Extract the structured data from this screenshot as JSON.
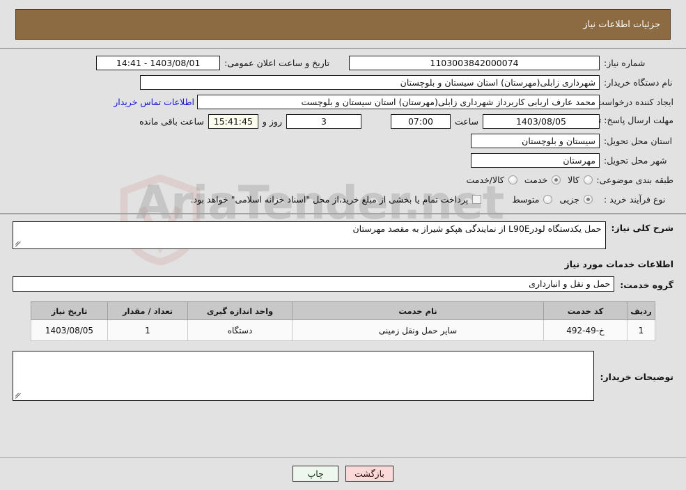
{
  "header": {
    "title": "جزئیات اطلاعات نیاز"
  },
  "watermark": {
    "text": "AriaTender.net",
    "shield_color": "#d4a0a0"
  },
  "form": {
    "need_number_label": "شماره نیاز:",
    "need_number_value": "1103003842000074",
    "announce_datetime_label": "تاریخ و ساعت اعلان عمومی:",
    "announce_datetime_value": "14:41 - 1403/08/01",
    "buyer_org_label": "نام دستگاه خریدار:",
    "buyer_org_value": "شهرداری زابلی(مهرستان) استان سیستان و بلوچستان",
    "creator_label": "ایجاد کننده درخواست:",
    "creator_value": "محمد عارف اربابی کاربرداز شهرداری زابلی(مهرستان) استان سیستان و بلوچست",
    "contact_link": "اطلاعات تماس خریدار",
    "deadline_label": "مهلت ارسال پاسخ: تا تاریخ:",
    "deadline_date": "1403/08/05",
    "deadline_hour_label": "ساعت",
    "deadline_hour": "07:00",
    "days_remaining": "3",
    "days_unit_label": "روز و",
    "countdown": "15:41:45",
    "countdown_label": "ساعت باقی مانده",
    "province_label": "استان محل تحویل:",
    "province_value": "سیستان و بلوچستان",
    "city_label": "شهر محل تحویل:",
    "city_value": "مهرستان",
    "category_label": "طبقه بندی موضوعی:",
    "category_options": [
      {
        "label": "کالا",
        "selected": false
      },
      {
        "label": "خدمت",
        "selected": true
      },
      {
        "label": "کالا/خدمت",
        "selected": false
      }
    ],
    "process_type_label": "نوع فرآیند خرید :",
    "process_type_options": [
      {
        "label": "جزیی",
        "selected": true
      },
      {
        "label": "متوسط",
        "selected": false
      }
    ],
    "treasury_checkbox_label": "پرداخت تمام یا بخشی از مبلغ خرید،از محل \"اسناد خزانه اسلامی\" خواهد بود.",
    "treasury_checked": false
  },
  "need_summary": {
    "label": "شرح کلی نیاز:",
    "value": "حمل یکدستگاه لودرL90E از نمایندگی هپکو شیراز به مقصد مهرستان"
  },
  "services_section": {
    "title": "اطلاعات خدمات مورد نیاز",
    "group_label": "گروه خدمت:",
    "group_value": "حمل و نقل و انبارداری"
  },
  "items_table": {
    "columns": [
      "ردیف",
      "کد خدمت",
      "نام خدمت",
      "واحد اندازه گیری",
      "تعداد / مقدار",
      "تاریخ نیاز"
    ],
    "rows": [
      {
        "row_no": "1",
        "code": "خ-49-492",
        "name": "سایر حمل ونقل زمینی",
        "unit": "دستگاه",
        "quantity": "1",
        "need_date": "1403/08/05"
      }
    ]
  },
  "buyer_notes": {
    "label": "توضیحات خریدار:",
    "value": ""
  },
  "footer": {
    "print_label": "چاپ",
    "back_label": "بازگشت"
  }
}
